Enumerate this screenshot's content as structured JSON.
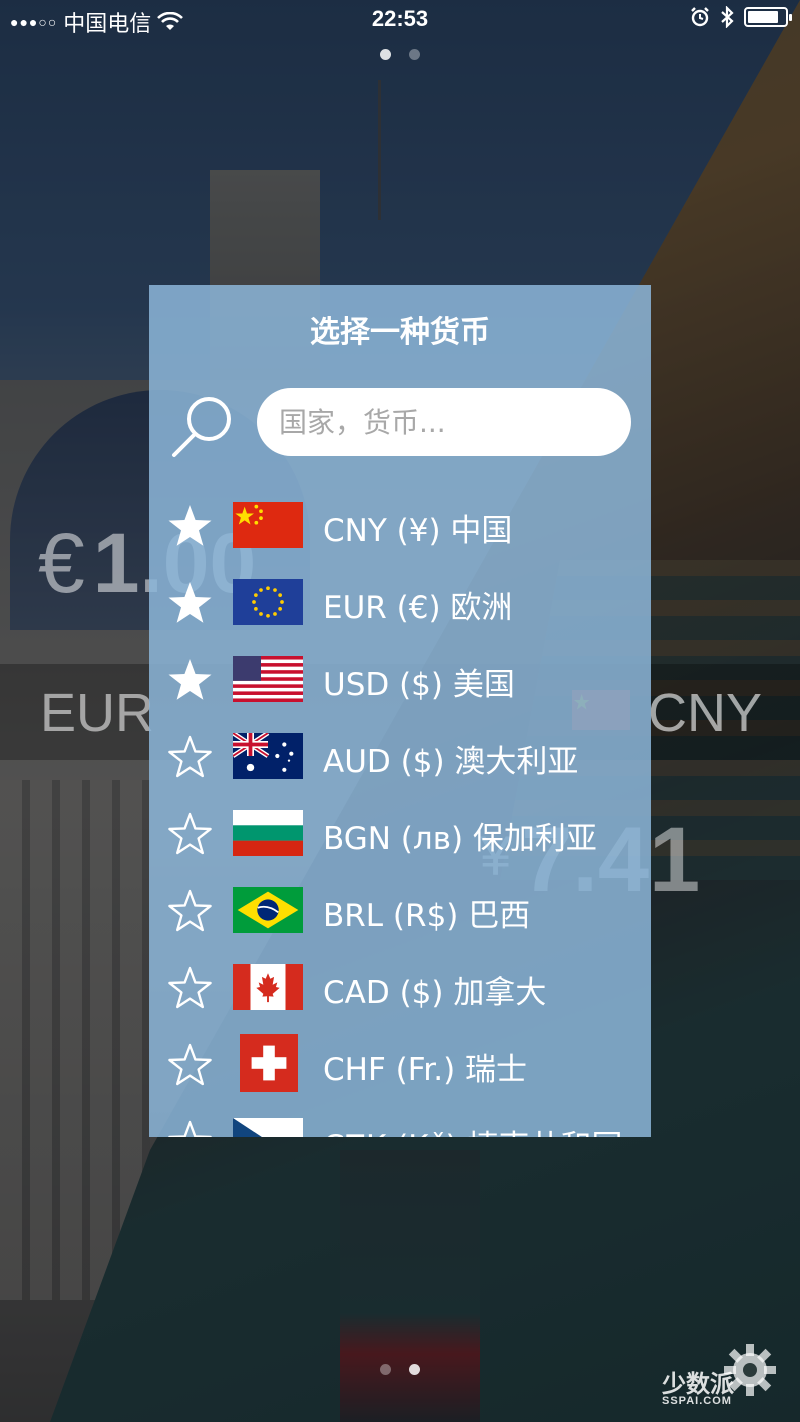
{
  "status_bar": {
    "carrier": "中国电信",
    "time": "22:53"
  },
  "converter": {
    "from_symbol": "€",
    "from_amount": "1.00",
    "from_code": "EUR",
    "to_symbol": "¥",
    "to_amount": "7.41",
    "to_code": "CNY"
  },
  "modal": {
    "title": "选择一种货币",
    "search_placeholder": "国家，货币...",
    "currencies": [
      {
        "label": "CNY (¥) 中国",
        "code": "CNY",
        "favorite": true,
        "flag": "china-flag"
      },
      {
        "label": "EUR (€) 欧洲",
        "code": "EUR",
        "favorite": true,
        "flag": "eu-flag"
      },
      {
        "label": "USD ($) 美国",
        "code": "USD",
        "favorite": true,
        "flag": "us-flag"
      },
      {
        "label": "AUD ($) 澳大利亚",
        "code": "AUD",
        "favorite": false,
        "flag": "australia-flag"
      },
      {
        "label": "BGN (лв) 保加利亚",
        "code": "BGN",
        "favorite": false,
        "flag": "bulgaria-flag"
      },
      {
        "label": "BRL (R$) 巴西",
        "code": "BRL",
        "favorite": false,
        "flag": "brazil-flag"
      },
      {
        "label": "CAD ($) 加拿大",
        "code": "CAD",
        "favorite": false,
        "flag": "canada-flag"
      },
      {
        "label": "CHF (Fr.) 瑞士",
        "code": "CHF",
        "favorite": false,
        "flag": "switzerland-flag"
      },
      {
        "label": "CZK (Kč) 捷克共和国",
        "code": "CZK",
        "favorite": false,
        "flag": "czech-flag"
      }
    ]
  },
  "watermark": {
    "text": "少数派",
    "sub": "SSPAI.COM"
  }
}
